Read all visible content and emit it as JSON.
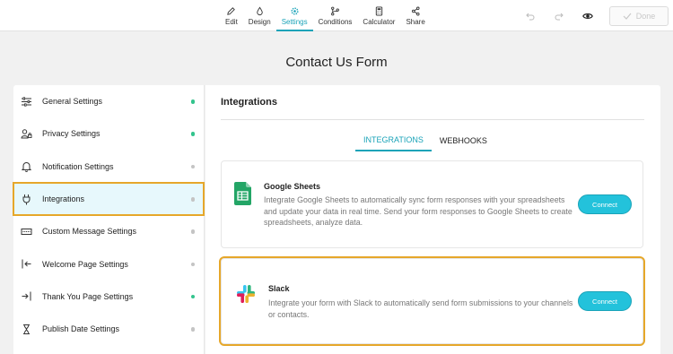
{
  "toolbar": {
    "tabs": [
      {
        "label": "Edit",
        "icon": "pencil-icon"
      },
      {
        "label": "Design",
        "icon": "droplet-icon"
      },
      {
        "label": "Settings",
        "icon": "gear-icon"
      },
      {
        "label": "Conditions",
        "icon": "branch-icon"
      },
      {
        "label": "Calculator",
        "icon": "calculator-icon"
      },
      {
        "label": "Share",
        "icon": "share-icon"
      }
    ],
    "active_tab": "Settings",
    "done_label": "Done"
  },
  "form_title": "Contact Us Form",
  "sidebar": {
    "items": [
      {
        "label": "General Settings",
        "icon": "sliders-icon",
        "status": "green"
      },
      {
        "label": "Privacy Settings",
        "icon": "user-lock-icon",
        "status": "green"
      },
      {
        "label": "Notification Settings",
        "icon": "bell-icon",
        "status": "gray"
      },
      {
        "label": "Integrations",
        "icon": "plug-icon",
        "status": "gray"
      },
      {
        "label": "Custom Message Settings",
        "icon": "message-icon",
        "status": "gray"
      },
      {
        "label": "Welcome Page Settings",
        "icon": "enter-icon",
        "status": "gray"
      },
      {
        "label": "Thank You Page Settings",
        "icon": "exit-icon",
        "status": "green"
      },
      {
        "label": "Publish Date Settings",
        "icon": "hourglass-icon",
        "status": "gray"
      }
    ],
    "active": "Integrations"
  },
  "main": {
    "heading": "Integrations",
    "subtabs": [
      "INTEGRATIONS",
      "WEBHOOKS"
    ],
    "active_subtab": "INTEGRATIONS",
    "cards": [
      {
        "title": "Google Sheets",
        "description": "Integrate Google Sheets to automatically sync form responses with your spreadsheets and update your data in real time. Send your form responses to Google Sheets to create spreadsheets, analyze data.",
        "button": "Connect",
        "icon": "google-sheets-icon"
      },
      {
        "title": "Slack",
        "description": "Integrate your form with Slack to automatically send form submissions to your channels or contacts.",
        "button": "Connect",
        "icon": "slack-icon"
      }
    ]
  },
  "colors": {
    "accent": "#1aa3b8",
    "connect_button": "#23c2db",
    "highlight": "#e6a72a",
    "status_green": "#33c48d",
    "status_gray": "#c4c4c4"
  }
}
